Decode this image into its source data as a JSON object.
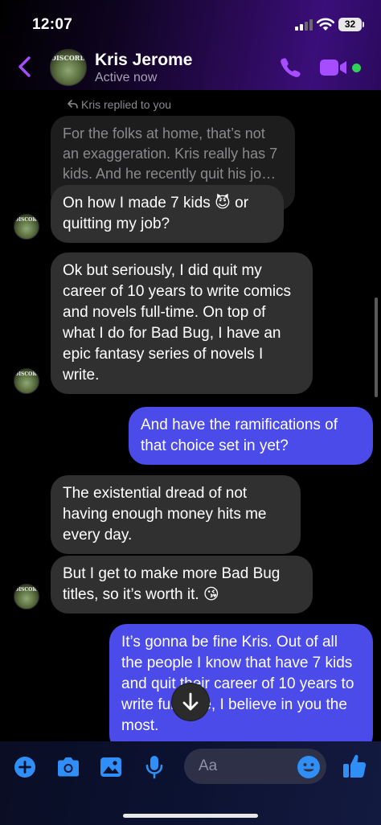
{
  "status_bar": {
    "time": "12:07",
    "battery": "32"
  },
  "header": {
    "contact_name": "Kris Jerome",
    "contact_status": "Active now",
    "avatar_text": "DISCORDIA"
  },
  "chat": {
    "reply_indicator": "Kris replied to you",
    "messages": [
      {
        "dir": "quoted",
        "text": "For the folks at home, that’s not an exaggeration. Kris really has 7 kids. And he recently quit his jo…"
      },
      {
        "dir": "in",
        "text": "On how I made 7 kids 😈 or quitting my job?"
      },
      {
        "dir": "in",
        "text": "Ok but seriously, I did quit my career of 10 years to write comics and novels full-time. On top of what I do for Bad Bug, I have an epic fantasy series of novels I write."
      },
      {
        "dir": "out",
        "text": "And have the ramifications of that choice set in yet?"
      },
      {
        "dir": "in",
        "text": "The existential dread of not having enough money hits me every day."
      },
      {
        "dir": "in",
        "text": "But I get to make more Bad Bug titles, so it’s worth it. 😘"
      },
      {
        "dir": "out",
        "text": "It’s gonna be fine Kris. Out of all the people I know that have 7 kids and quit their career of 10 years to write full-time, I believe in you the most."
      }
    ]
  },
  "composer": {
    "placeholder": "Aa"
  },
  "colors": {
    "accent": "#a64dff",
    "incoming_bubble": "#303030",
    "outgoing_bubble": "#4a4be8",
    "composer_icons": "#2f8ff7",
    "online": "#31d158"
  },
  "icons": [
    "back-icon",
    "phone-icon",
    "video-icon",
    "plus-icon",
    "camera-icon",
    "image-icon",
    "microphone-icon",
    "emoji-icon",
    "thumbs-up-icon",
    "arrow-down-icon",
    "reply-arrow-icon"
  ]
}
